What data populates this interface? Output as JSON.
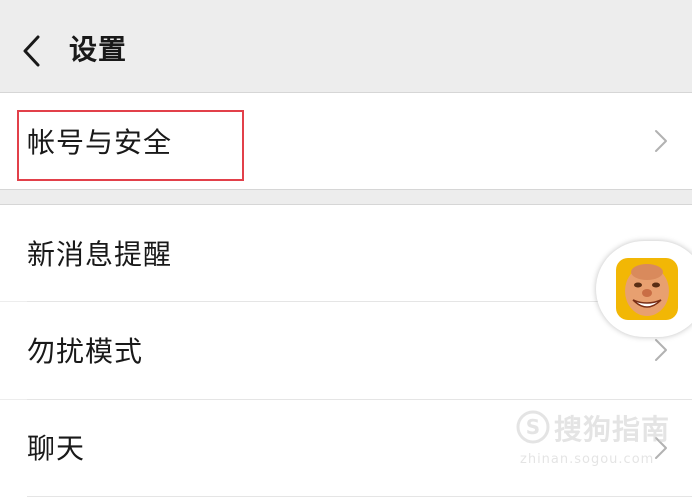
{
  "header": {
    "title": "设置",
    "back_icon": "chevron-left-icon"
  },
  "settings": {
    "account_security": "帐号与安全",
    "new_message_notify": "新消息提醒",
    "do_not_disturb": "勿扰模式",
    "chat": "聊天"
  },
  "chevron_icon": "chevron-right-icon",
  "floating_bubble": {
    "avatar_icon": "emoji-face-icon"
  },
  "watermark": {
    "text": "搜狗指南",
    "url": "zhinan.sogou.com"
  },
  "colors": {
    "background": "#ededed",
    "highlight_border": "#e2404a",
    "text": "#191919",
    "chevron": "#b2b2b2"
  }
}
